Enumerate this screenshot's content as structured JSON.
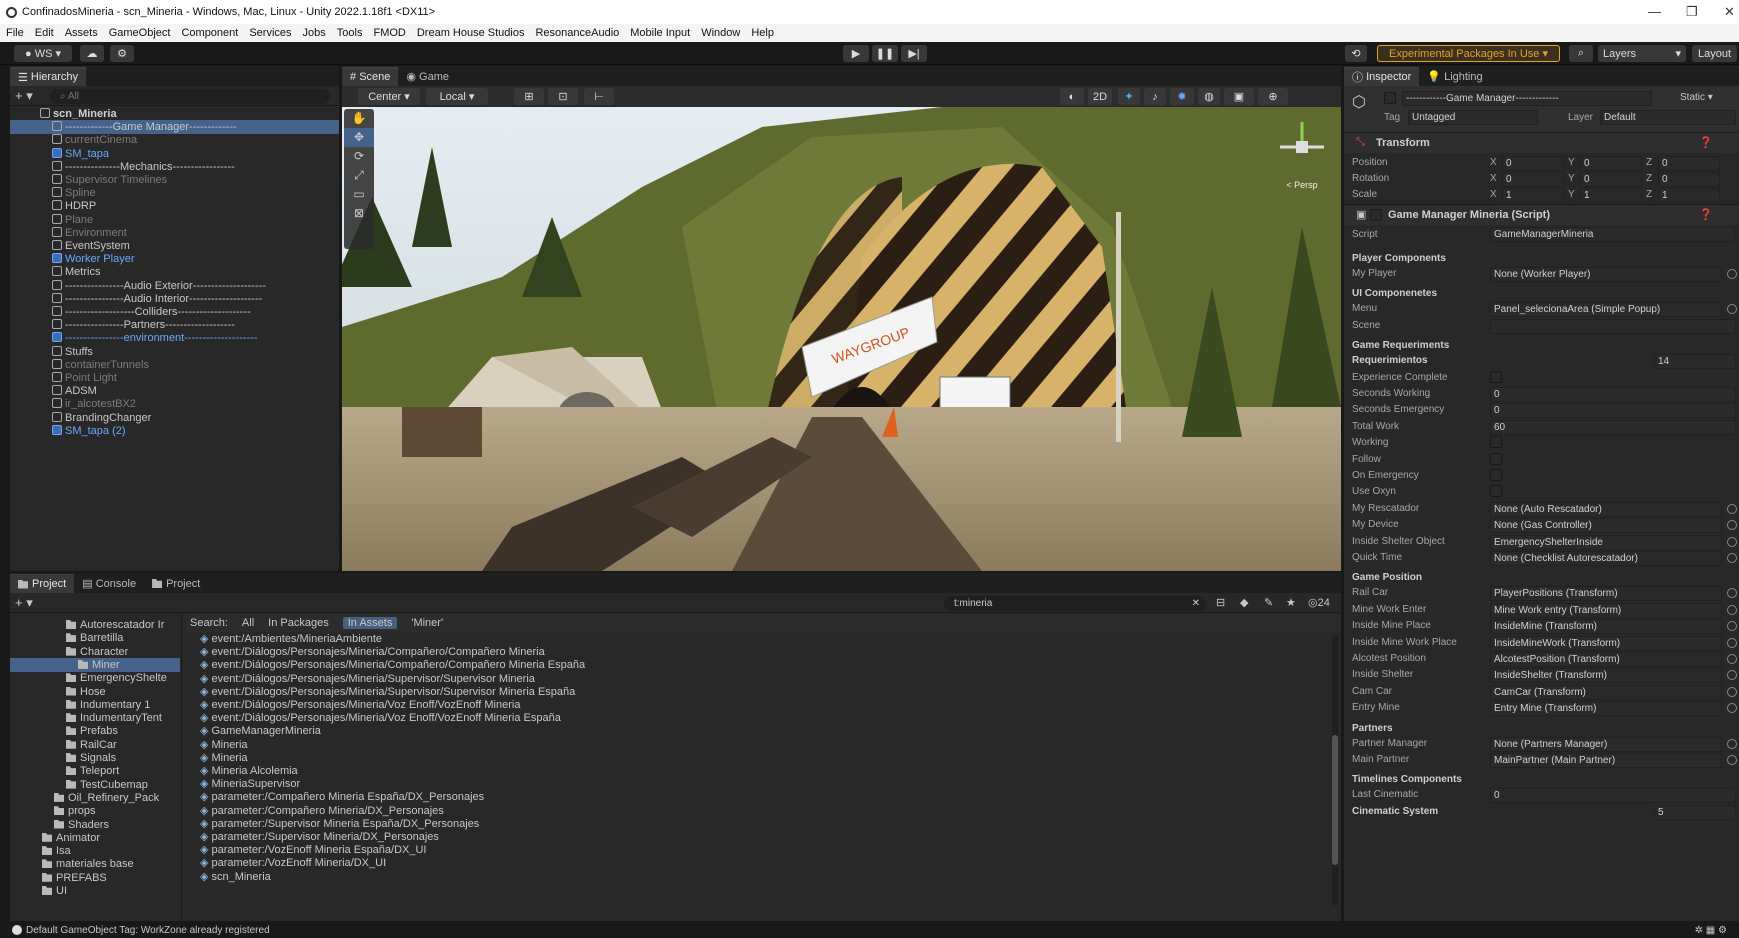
{
  "window": {
    "title": "ConfinadosMineria - scn_Mineria - Windows, Mac, Linux - Unity 2022.1.18f1 <DX11>",
    "minimize": "—",
    "maximize": "❐",
    "close": "✕"
  },
  "menu": [
    "File",
    "Edit",
    "Assets",
    "GameObject",
    "Component",
    "Services",
    "Jobs",
    "Tools",
    "FMOD",
    "Dream House Studios",
    "ResonanceAudio",
    "Mobile Input",
    "Window",
    "Help"
  ],
  "toolbar": {
    "account": "WS ▾",
    "experimental": "Experimental Packages In Use ▾",
    "layers": "Layers",
    "layout": "Layout"
  },
  "hierarchy": {
    "tab": "Hierarchy",
    "search_placeholder": "All",
    "items": [
      {
        "label": "scn_Mineria",
        "depth": 0,
        "style": "hdr"
      },
      {
        "label": "-------------Game Manager-------------",
        "depth": 1,
        "style": "sel"
      },
      {
        "label": "currentCinema",
        "depth": 1,
        "style": "dim"
      },
      {
        "label": "SM_tapa",
        "depth": 1,
        "style": "blue"
      },
      {
        "label": "---------------Mechanics-----------------",
        "depth": 1,
        "style": ""
      },
      {
        "label": "Supervisor Timelines",
        "depth": 1,
        "style": "dim"
      },
      {
        "label": "Spline",
        "depth": 1,
        "style": "dim"
      },
      {
        "label": "HDRP",
        "depth": 1,
        "style": ""
      },
      {
        "label": "Plane",
        "depth": 1,
        "style": "dim"
      },
      {
        "label": "Environment",
        "depth": 1,
        "style": "dim"
      },
      {
        "label": "EventSystem",
        "depth": 1,
        "style": ""
      },
      {
        "label": "Worker Player",
        "depth": 1,
        "style": "blue"
      },
      {
        "label": "Metrics",
        "depth": 1,
        "style": ""
      },
      {
        "label": "----------------Audio Exterior--------------------",
        "depth": 1,
        "style": ""
      },
      {
        "label": "----------------Audio Interior--------------------",
        "depth": 1,
        "style": ""
      },
      {
        "label": "-------------------Colliders--------------------",
        "depth": 1,
        "style": ""
      },
      {
        "label": "----------------Partners-------------------",
        "depth": 1,
        "style": ""
      },
      {
        "label": "----------------environment--------------------",
        "depth": 1,
        "style": "blue"
      },
      {
        "label": "Stuffs",
        "depth": 1,
        "style": ""
      },
      {
        "label": "containerTunnels",
        "depth": 1,
        "style": "dim"
      },
      {
        "label": "Point Light",
        "depth": 1,
        "style": "dim"
      },
      {
        "label": "ADSM",
        "depth": 1,
        "style": ""
      },
      {
        "label": "ir_alcotestBX2",
        "depth": 1,
        "style": "dim"
      },
      {
        "label": "BrandingChanger",
        "depth": 1,
        "style": ""
      },
      {
        "label": "SM_tapa (2)",
        "depth": 1,
        "style": "blue"
      }
    ]
  },
  "scene": {
    "tabs": [
      "Scene",
      "Game"
    ],
    "pivot": "Center ▾",
    "space": "Local ▾",
    "mode2d": "2D",
    "persp": "< Persp",
    "banner": "WAYGROUP"
  },
  "inspector": {
    "tabs": [
      "Inspector",
      "Lighting"
    ],
    "object_name": "------------Game Manager-------------",
    "static": "Static ▾",
    "tag_label": "Tag",
    "tag": "Untagged",
    "layer_label": "Layer",
    "layer": "Default",
    "transform": {
      "title": "Transform",
      "rows": [
        {
          "label": "Position",
          "x": "0",
          "y": "0",
          "z": "0"
        },
        {
          "label": "Rotation",
          "x": "0",
          "y": "0",
          "z": "0"
        },
        {
          "label": "Scale",
          "x": "1",
          "y": "1",
          "z": "1"
        }
      ]
    },
    "script": {
      "title": "Game Manager Mineria (Script)",
      "script_label": "Script",
      "script_value": "GameManagerMineria"
    },
    "fields": [
      {
        "t": "group",
        "label": "Player Components"
      },
      {
        "label": "My Player",
        "value": "None (Worker Player)",
        "dot": true
      },
      {
        "t": "group",
        "label": "UI Componenetes"
      },
      {
        "label": "Menu",
        "value": "Panel_selecionaArea (Simple Popup)",
        "dot": true
      },
      {
        "label": "Scene",
        "value": ""
      },
      {
        "t": "group",
        "label": "Game Requeriments"
      },
      {
        "t": "bold",
        "label": "Requerimientos",
        "value": "14"
      },
      {
        "label": "Experience Complete",
        "check": true
      },
      {
        "label": "Seconds Working",
        "value": "0"
      },
      {
        "label": "Seconds Emergency",
        "value": "0"
      },
      {
        "label": "Total Work",
        "value": "60"
      },
      {
        "label": "Working",
        "check": true
      },
      {
        "label": "Follow",
        "check": true
      },
      {
        "label": "On Emergency",
        "check": true
      },
      {
        "label": "Use Oxyn",
        "check": true
      },
      {
        "label": "My Rescatador",
        "value": "None (Auto Rescatador)",
        "dot": true
      },
      {
        "label": "My Device",
        "value": "None (Gas Controller)",
        "dot": true
      },
      {
        "label": "Inside Shelter Object",
        "value": "EmergencyShelterInside",
        "dot": true
      },
      {
        "label": "Quick Time",
        "value": "None (Checklist Autorescatador)",
        "dot": true
      },
      {
        "t": "group",
        "label": "Game Position"
      },
      {
        "label": "Rail Car",
        "value": "PlayerPositions (Transform)",
        "dot": true
      },
      {
        "label": "Mine Work Enter",
        "value": "Mine Work entry (Transform)",
        "dot": true
      },
      {
        "label": "Inside Mine Place",
        "value": "InsideMine (Transform)",
        "dot": true
      },
      {
        "label": "Inside Mine Work Place",
        "value": "InsideMineWork (Transform)",
        "dot": true
      },
      {
        "label": "Alcotest Position",
        "value": "AlcotestPosition (Transform)",
        "dot": true
      },
      {
        "label": "Inside Shelter",
        "value": "InsideShelter (Transform)",
        "dot": true
      },
      {
        "label": "Cam Car",
        "value": "CamCar (Transform)",
        "dot": true
      },
      {
        "label": "Entry Mine",
        "value": "Entry Mine (Transform)",
        "dot": true
      },
      {
        "t": "group",
        "label": "Partners"
      },
      {
        "label": "Partner Manager",
        "value": "None (Partners Manager)",
        "dot": true
      },
      {
        "label": "Main Partner",
        "value": "MainPartner (Main Partner)",
        "dot": true
      },
      {
        "t": "group",
        "label": "Timelines Components"
      },
      {
        "label": "Last Cinematic",
        "value": "0"
      },
      {
        "t": "bold",
        "label": "Cinematic System",
        "value": "5"
      }
    ]
  },
  "project": {
    "tabs": [
      "Project",
      "Console",
      "Project"
    ],
    "search": "t:mineria",
    "count": "24",
    "search_scope": {
      "label": "Search:",
      "all": "All",
      "packages": "In Packages",
      "assets": "In Assets",
      "query": "'Miner'"
    },
    "folders": [
      {
        "label": "Autorescatador Ir",
        "depth": 3
      },
      {
        "label": "Barretilla",
        "depth": 3
      },
      {
        "label": "Character",
        "depth": 3
      },
      {
        "label": "Miner",
        "depth": 4,
        "sel": true
      },
      {
        "label": "EmergencyShelte",
        "depth": 3
      },
      {
        "label": "Hose",
        "depth": 3
      },
      {
        "label": "Indumentary 1",
        "depth": 3
      },
      {
        "label": "IndumentaryTent",
        "depth": 3
      },
      {
        "label": "Prefabs",
        "depth": 3
      },
      {
        "label": "RailCar",
        "depth": 3
      },
      {
        "label": "Signals",
        "depth": 3
      },
      {
        "label": "Teleport",
        "depth": 3
      },
      {
        "label": "TestCubemap",
        "depth": 3
      },
      {
        "label": "Oil_Refinery_Pack",
        "depth": 2
      },
      {
        "label": "props",
        "depth": 2
      },
      {
        "label": "Shaders",
        "depth": 2
      },
      {
        "label": "Animator",
        "depth": 1
      },
      {
        "label": "Isa",
        "depth": 1
      },
      {
        "label": "materiales base",
        "depth": 1
      },
      {
        "label": "PREFABS",
        "depth": 1
      },
      {
        "label": "UI",
        "depth": 1
      }
    ],
    "results": [
      "event:/Ambientes/MineriaAmbiente",
      "event:/Diálogos/Personajes/Mineria/Compañero/Compañero Mineria",
      "event:/Diálogos/Personajes/Mineria/Compañero/Compañero Mineria España",
      "event:/Diálogos/Personajes/Mineria/Supervisor/Supervisor Mineria",
      "event:/Diálogos/Personajes/Mineria/Supervisor/Supervisor Mineria España",
      "event:/Diálogos/Personajes/Mineria/Voz Enoff/VozEnoff Mineria",
      "event:/Diálogos/Personajes/Mineria/Voz Enoff/VozEnoff Mineria España",
      "GameManagerMineria",
      "Mineria",
      "Mineria",
      "Mineria Alcolemia",
      "MineriaSupervisor",
      "parameter:/Compañero Mineria España/DX_Personajes",
      "parameter:/Compañero Mineria/DX_Personajes",
      "parameter:/Supervisor Mineria España/DX_Personajes",
      "parameter:/Supervisor Mineria/DX_Personajes",
      "parameter:/VozEnoff Mineria España/DX_UI",
      "parameter:/VozEnoff Mineria/DX_UI",
      "scn_Mineria"
    ]
  },
  "status": {
    "message": "Default GameObject Tag: WorkZone already registered"
  },
  "colors": {
    "accent": "#44628a",
    "experimental": "#e8a020",
    "bg": "#282828"
  }
}
